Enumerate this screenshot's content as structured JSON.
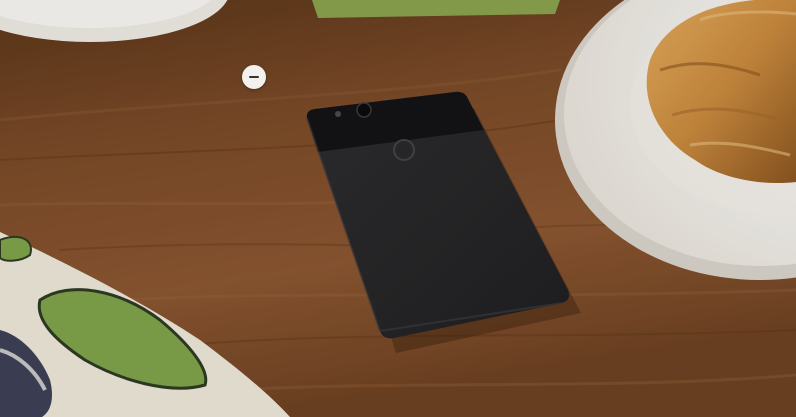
{
  "scene": {
    "subject": "smartphone-back",
    "icons": {
      "overlay_control": "minus-icon"
    },
    "colors": {
      "table_wood": "#7a4a28",
      "phone_body": "#2a2a2c",
      "phone_glass": "#141416",
      "plate": "#f4f1ec",
      "croissant": "#c98a3e",
      "napkin_green": "#7fa34a"
    }
  }
}
